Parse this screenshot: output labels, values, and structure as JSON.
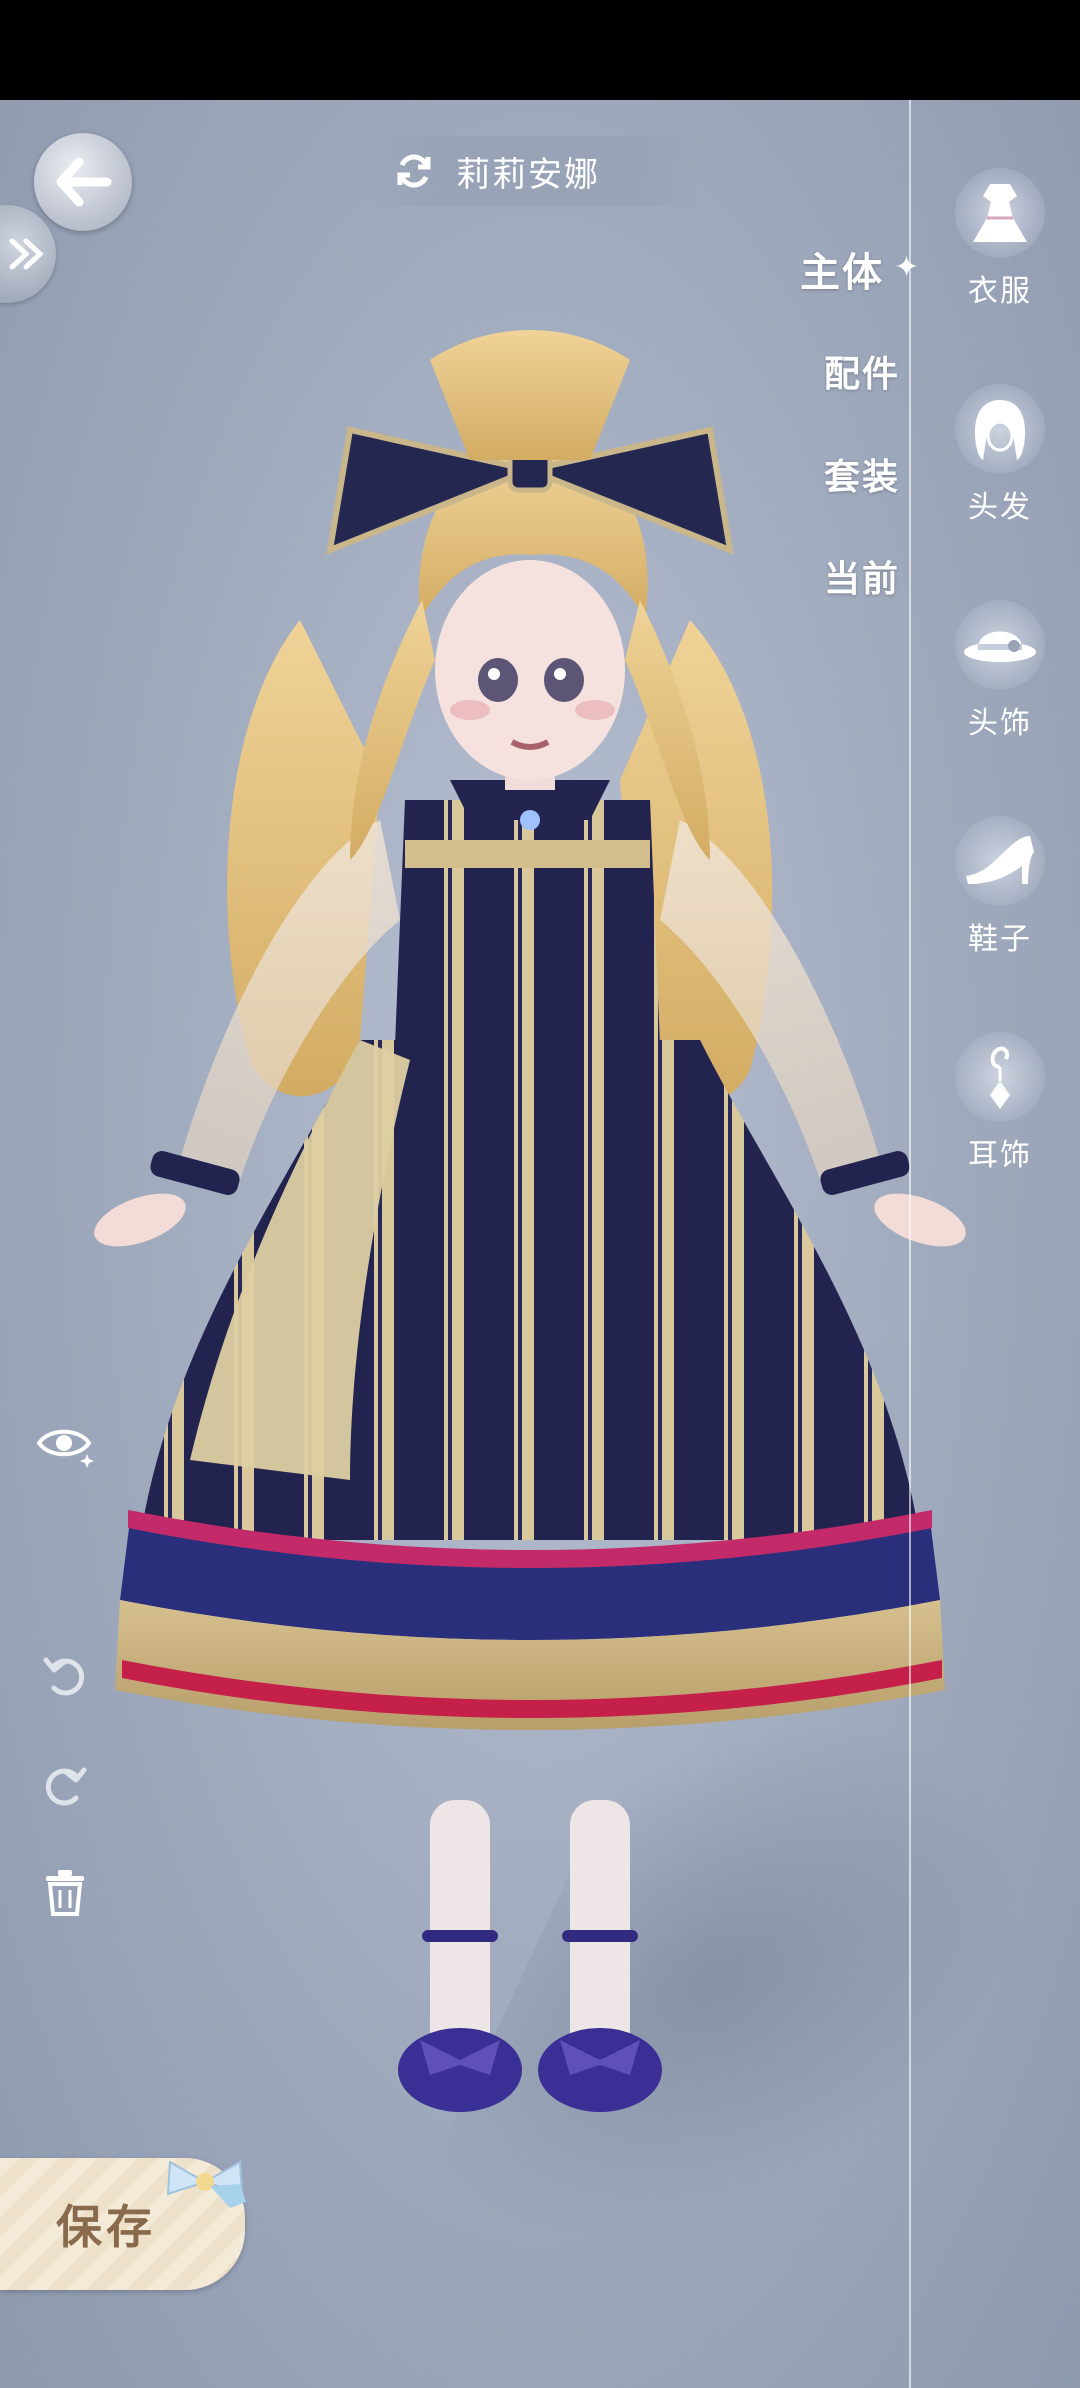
{
  "header": {
    "character_name": "莉莉安娜",
    "back_icon": "back-arrow-icon",
    "expand_icon": "double-chevron-right-icon",
    "switch_icon": "refresh-swap-icon"
  },
  "tabs": [
    {
      "label": "主体",
      "active": true
    },
    {
      "label": "配件",
      "active": false
    },
    {
      "label": "套装",
      "active": false
    },
    {
      "label": "当前",
      "active": false
    }
  ],
  "categories": [
    {
      "label": "衣服",
      "icon": "dress-icon"
    },
    {
      "label": "头发",
      "icon": "hair-icon"
    },
    {
      "label": "头饰",
      "icon": "hat-icon"
    },
    {
      "label": "鞋子",
      "icon": "high-heel-icon"
    },
    {
      "label": "耳饰",
      "icon": "earring-icon"
    }
  ],
  "tools": {
    "visibility_icon": "eye-sparkle-icon",
    "undo_icon": "undo-icon",
    "redo_icon": "redo-icon",
    "delete_icon": "trash-icon"
  },
  "save": {
    "label": "保存"
  },
  "colors": {
    "background": "#a3adc0",
    "dress_navy": "#23234f",
    "dress_gold": "#d8c79a",
    "hair_blonde": "#e3c07e",
    "save_text": "#8a6a4c"
  }
}
